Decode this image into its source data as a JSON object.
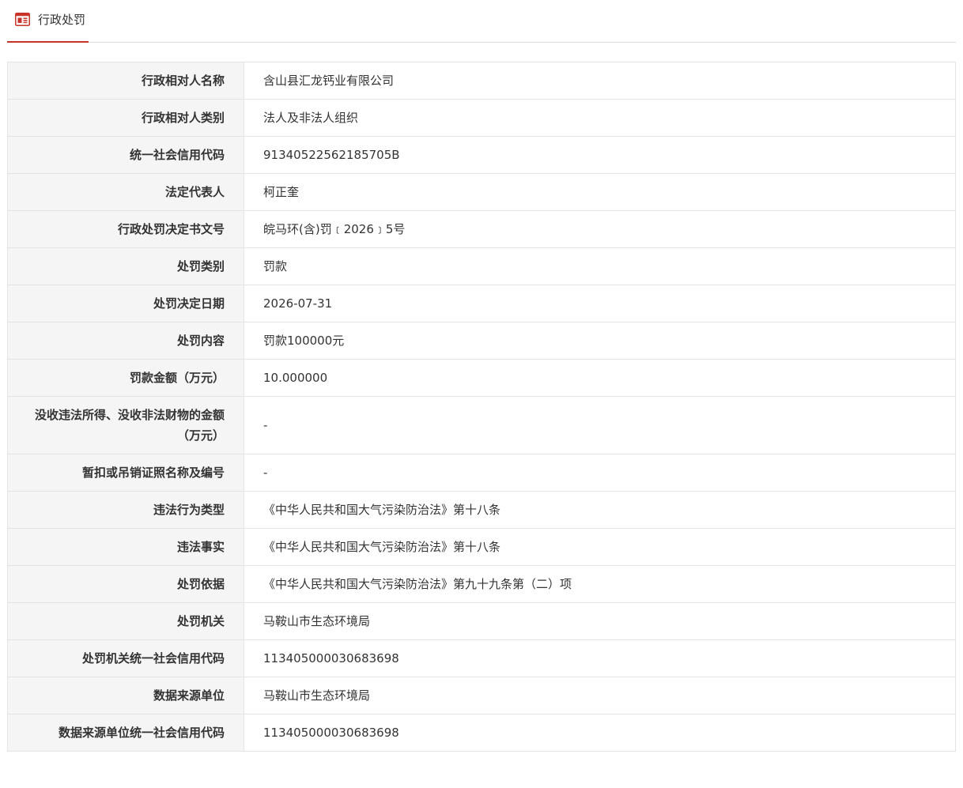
{
  "header": {
    "title": "行政处罚",
    "icon": "document-icon",
    "accent_color": "#c8342a"
  },
  "rows": [
    {
      "label": "行政相对人名称",
      "value": "含山县汇龙钙业有限公司"
    },
    {
      "label": "行政相对人类别",
      "value": "法人及非法人组织"
    },
    {
      "label": "统一社会信用代码",
      "value": "91340522562185705B"
    },
    {
      "label": "法定代表人",
      "value": "柯正奎"
    },
    {
      "label": "行政处罚决定书文号",
      "value": "皖马环(含)罚﹝2026﹞5号"
    },
    {
      "label": "处罚类别",
      "value": "罚款"
    },
    {
      "label": "处罚决定日期",
      "value": "2026-07-31"
    },
    {
      "label": "处罚内容",
      "value": "罚款100000元"
    },
    {
      "label": "罚款金额（万元）",
      "value": "10.000000"
    },
    {
      "label": "没收违法所得、没收非法财物的金额（万元）",
      "value": "-"
    },
    {
      "label": "暂扣或吊销证照名称及编号",
      "value": "-"
    },
    {
      "label": "违法行为类型",
      "value": "《中华人民共和国大气污染防治法》第十八条"
    },
    {
      "label": "违法事实",
      "value": "《中华人民共和国大气污染防治法》第十八条"
    },
    {
      "label": "处罚依据",
      "value": "《中华人民共和国大气污染防治法》第九十九条第（二）项"
    },
    {
      "label": "处罚机关",
      "value": "马鞍山市生态环境局"
    },
    {
      "label": "处罚机关统一社会信用代码",
      "value": "113405000030683698"
    },
    {
      "label": "数据来源单位",
      "value": "马鞍山市生态环境局"
    },
    {
      "label": "数据来源单位统一社会信用代码",
      "value": "113405000030683698"
    }
  ]
}
